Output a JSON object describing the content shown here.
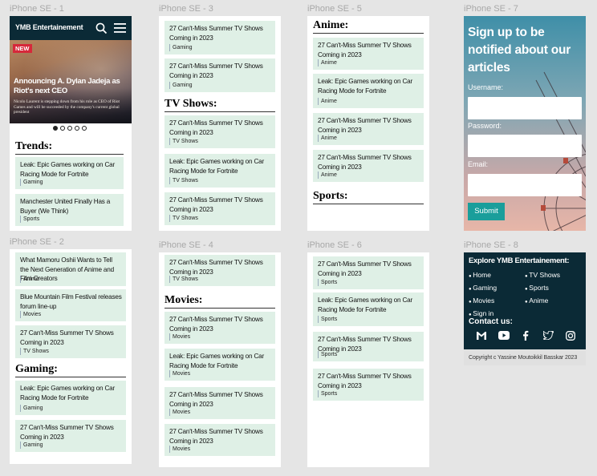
{
  "frames": {
    "f1": "iPhone SE - 1",
    "f2": "iPhone SE - 2",
    "f3": "iPhone SE - 3",
    "f4": "iPhone SE - 4",
    "f5": "iPhone SE - 5",
    "f6": "iPhone SE - 6",
    "f7": "iPhone SE - 7",
    "f8": "iPhone SE - 8"
  },
  "header": {
    "brand": "YMB Entertainement"
  },
  "hero": {
    "badge": "NEW",
    "title": "Announcing A. Dylan Jadeja as Riot's next CEO",
    "desc": "Nicolo Laurent is stepping down from his role as CEO of Riot Games and will be succeeded by the company's current global president",
    "dots": 5,
    "active_dot": 1
  },
  "sections": {
    "trends": "Trends:",
    "gaming": "Gaming:",
    "tvshows": "TV Shows:",
    "movies": "Movies:",
    "anime": "Anime:",
    "sports": "Sports:"
  },
  "cards": {
    "f1": [
      {
        "title": "Leak: Epic Games working on Car Racing Mode for Fortnite",
        "tag": "Gaming"
      },
      {
        "title": "Manchester United Finally Has a Buyer (We Think)",
        "tag": "Sports"
      }
    ],
    "f2_top": [
      {
        "title": "What Mamoru Oshii Wants to Tell the Next Generation of Anime and Film Creators",
        "tag": "Anime"
      },
      {
        "title": "Blue Mountain Film Festival releases forum line-up",
        "tag": "Movies"
      },
      {
        "title": "27 Can't-Miss Summer TV Shows Coming in 2023",
        "tag": "TV Shows"
      }
    ],
    "f2_gaming": [
      {
        "title": "Leak: Epic Games working on Car Racing Mode for Fortnite",
        "tag": "Gaming"
      },
      {
        "title": "27 Can't-Miss Summer TV Shows Coming in 2023",
        "tag": "Gaming"
      }
    ],
    "f3_top": [
      {
        "title": "27 Can't-Miss Summer TV Shows Coming in 2023",
        "tag": "Gaming"
      },
      {
        "title": "27 Can't-Miss Summer TV Shows Coming in 2023",
        "tag": "Gaming"
      }
    ],
    "f3_tv": [
      {
        "title": "27 Can't-Miss Summer TV Shows Coming in 2023",
        "tag": "TV Shows"
      },
      {
        "title": "Leak: Epic Games working on Car Racing Mode for Fortnite",
        "tag": "TV Shows"
      },
      {
        "title": "27 Can't-Miss Summer TV Shows Coming in 2023",
        "tag": "TV Shows"
      }
    ],
    "f4_top": [
      {
        "title": "27 Can't-Miss Summer TV Shows Coming in 2023",
        "tag": "TV Shows"
      }
    ],
    "f4_movies": [
      {
        "title": "27 Can't-Miss Summer TV Shows Coming in 2023",
        "tag": "Movies"
      },
      {
        "title": "Leak: Epic Games working on Car Racing Mode for Fortnite",
        "tag": "Movies"
      },
      {
        "title": "27 Can't-Miss Summer TV Shows Coming in 2023",
        "tag": "Movies"
      },
      {
        "title": "27 Can't-Miss Summer TV Shows Coming in 2023",
        "tag": "Movies"
      }
    ],
    "f5_anime": [
      {
        "title": "27 Can't-Miss Summer TV Shows Coming in 2023",
        "tag": "Anime"
      },
      {
        "title": "Leak: Epic Games working on Car Racing Mode for Fortnite",
        "tag": "Anime"
      },
      {
        "title": "27 Can't-Miss Summer TV Shows Coming in 2023",
        "tag": "Anime"
      },
      {
        "title": "27 Can't-Miss Summer TV Shows Coming in 2023",
        "tag": "Anime"
      }
    ],
    "f6": [
      {
        "title": "27 Can't-Miss Summer TV Shows Coming in 2023",
        "tag": "Sports"
      },
      {
        "title": "Leak: Epic Games working on Car Racing Mode for Fortnite",
        "tag": "Sports"
      },
      {
        "title": "27 Can't-Miss Summer TV Shows Coming in 2023",
        "tag": "Sports"
      },
      {
        "title": "27 Can't-Miss Summer TV Shows Coming in 2023",
        "tag": "Sports"
      }
    ]
  },
  "signup": {
    "heading": "Sign up to be notified about our articles",
    "username_label": "Username:",
    "password_label": "Password:",
    "email_label": "Email:",
    "submit": "Submit"
  },
  "footer": {
    "explore": "Explore YMB Entertainement:",
    "links_left": [
      "Home",
      "Gaming",
      "Movies",
      "Sign in"
    ],
    "links_right": [
      "TV Shows",
      "Sports",
      "Anime"
    ],
    "contact": "Contact us:",
    "social_icons": [
      "gmail-icon",
      "youtube-icon",
      "facebook-icon",
      "twitter-icon",
      "instagram-icon"
    ],
    "copyright": "Copyright c Yassine Moutoikkil Basskar 2023"
  },
  "colors": {
    "dark": "#0b2a36",
    "card": "#dff0e6",
    "accent": "#1a9e9b",
    "badge": "#d6283a"
  }
}
